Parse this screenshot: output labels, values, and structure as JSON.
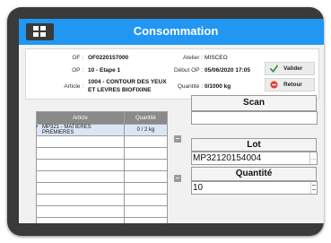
{
  "header": {
    "title": "Consommation",
    "menu_icon": "grid-menu-icon"
  },
  "info": {
    "of_label": "OF :",
    "of_value": "OF0220157000",
    "op_label": "OP :",
    "op_value": "10 - Etape 1",
    "article_label": "Article :",
    "article_value_line1": "1004 - CONTOUR DES YEUX",
    "article_value_line2": "ET LEVRES BIOFIXINE",
    "atelier_label": "Atelier :",
    "atelier_value": "MISCEO",
    "debut_label": "Début OP :",
    "debut_value": "05/06/2020 17:05",
    "quantite_label": "Quantité :",
    "quantite_value": "0/1000 kg"
  },
  "actions": {
    "valider_label": "Valider",
    "retour_label": "Retour",
    "valider_color": "#2e9e3a",
    "retour_color": "#e53935"
  },
  "table": {
    "columns": [
      "Article",
      "Quantité"
    ],
    "row_marker": "*",
    "rows": [
      {
        "article": "MP321 - MATIERES PREMIERES",
        "quantite": "0 / 2 kg"
      }
    ]
  },
  "scan": {
    "scan_header": "Scan",
    "scan_value": "",
    "lot_header": "Lot",
    "lot_value": "MP32120154004",
    "lot_button": "...",
    "quantite_header": "Quantité",
    "quantite_value": "10"
  },
  "colors": {
    "accent": "#2196f3",
    "bezel": "#3a3a3a"
  }
}
